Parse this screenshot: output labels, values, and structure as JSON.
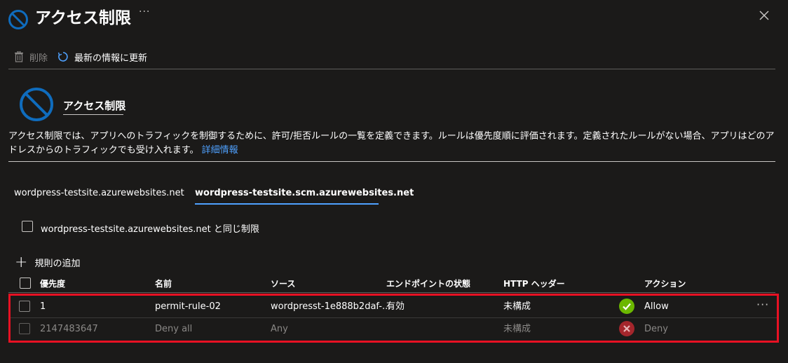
{
  "header": {
    "title": "アクセス制限",
    "more": "···"
  },
  "toolbar": {
    "delete_label": "削除",
    "refresh_label": "最新の情報に更新"
  },
  "section": {
    "title": "アクセス制限",
    "description": "アクセス制限では、アプリへのトラフィックを制御するために、許可/拒否ルールの一覧を定義できます。ルールは優先度順に評価されます。定義されたルールがない場合、アプリはどのアドレスからのトラフィックでも受け入れます。",
    "learn_more": "詳細情報"
  },
  "tabs": [
    {
      "label": "wordpress-testsite.azurewebsites.net",
      "active": false
    },
    {
      "label": "wordpress-testsite.scm.azurewebsites.net",
      "active": true
    }
  ],
  "same_restriction_label": "wordpress-testsite.azurewebsites.net と同じ制限",
  "add_rule_label": "規則の追加",
  "columns": {
    "priority": "優先度",
    "name": "名前",
    "source": "ソース",
    "endpoint_status": "エンドポイントの状態",
    "http_headers": "HTTP ヘッダー",
    "action": "アクション"
  },
  "rows": [
    {
      "priority": "1",
      "name": "permit-rule-02",
      "source": "wordpresst-1e888b2daf-...",
      "endpoint_status": "有効",
      "http_headers": "未構成",
      "action": "Allow",
      "more": "···"
    },
    {
      "priority": "2147483647",
      "name": "Deny all",
      "source": "Any",
      "endpoint_status": "",
      "http_headers": "未構成",
      "action": "Deny"
    }
  ],
  "colors": {
    "accent": "#4fa1ff",
    "allow": "#6bb700",
    "deny": "#a4262c",
    "highlight": "#e81123",
    "background": "#1b1a19"
  }
}
